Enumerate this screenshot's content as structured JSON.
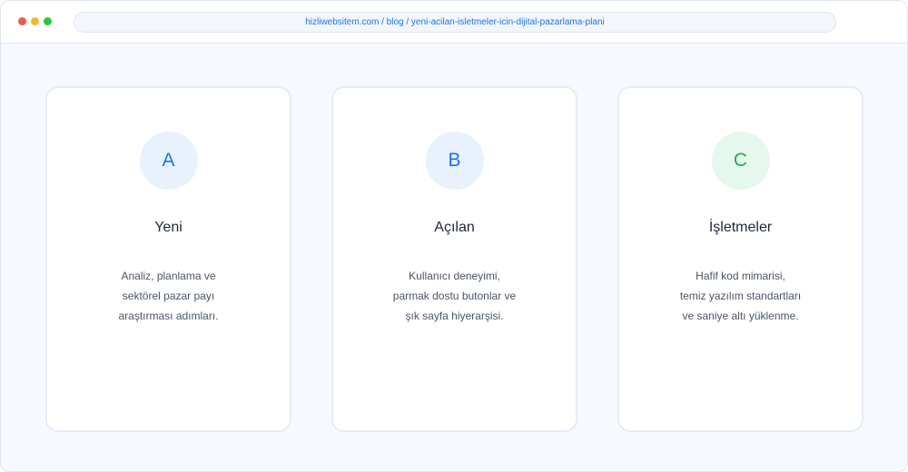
{
  "browser": {
    "url": "hizliwebsitem.com / blog / yeni-acilan-isletmeler-icin-dijital-pazarlama-plani",
    "controls": [
      {
        "name": "close-dot",
        "color": "#ee5a52"
      },
      {
        "name": "minimize-dot",
        "color": "#f5b82e"
      },
      {
        "name": "maximize-dot",
        "color": "#2bc740"
      }
    ]
  },
  "cards": [
    {
      "badge": "A",
      "badge_color": "#1a73e8",
      "badge_bg": "#e8f1fc",
      "title": "Yeni",
      "lines": [
        "Analiz, planlama ve",
        "sektörel pazar payı",
        "araştırması adımları."
      ]
    },
    {
      "badge": "B",
      "badge_color": "#1a73e8",
      "badge_bg": "#e8f1fc",
      "title": "Açılan",
      "lines": [
        "Kullanıcı deneyimi,",
        "parmak dostu butonlar ve",
        "şık sayfa hiyerarşisi."
      ]
    },
    {
      "badge": "C",
      "badge_color": "#1fae5b",
      "badge_bg": "#e6f7ed",
      "title": "İşletmeler",
      "lines": [
        "Hafif kod mimarisi,",
        "temiz yazılım standartları",
        "ve saniye altı yüklenme."
      ]
    }
  ]
}
